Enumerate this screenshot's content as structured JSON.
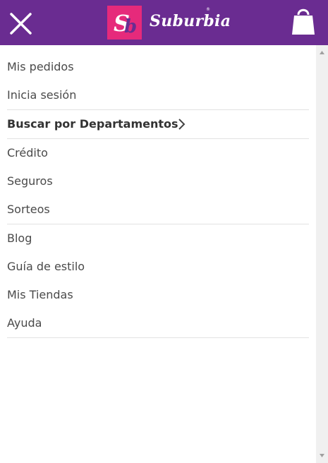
{
  "header": {
    "close_icon": "close-icon",
    "brand_monogram": "Sb",
    "brand_name": "Suburbia",
    "brand_reg": "®",
    "bag_icon": "shopping-bag-icon",
    "bg_color": "#6a2c91",
    "brand_color": "#e62a7b"
  },
  "menu": {
    "groups": [
      {
        "items": [
          "Mis pedidos",
          "Inicia sesión"
        ]
      },
      {
        "items": [
          "Buscar por Departamentos"
        ]
      },
      {
        "items": [
          "Crédito",
          "Seguros",
          "Sorteos"
        ]
      },
      {
        "items": [
          "Blog",
          "Guía de estilo",
          "Mis Tiendas",
          "Ayuda"
        ]
      }
    ]
  }
}
